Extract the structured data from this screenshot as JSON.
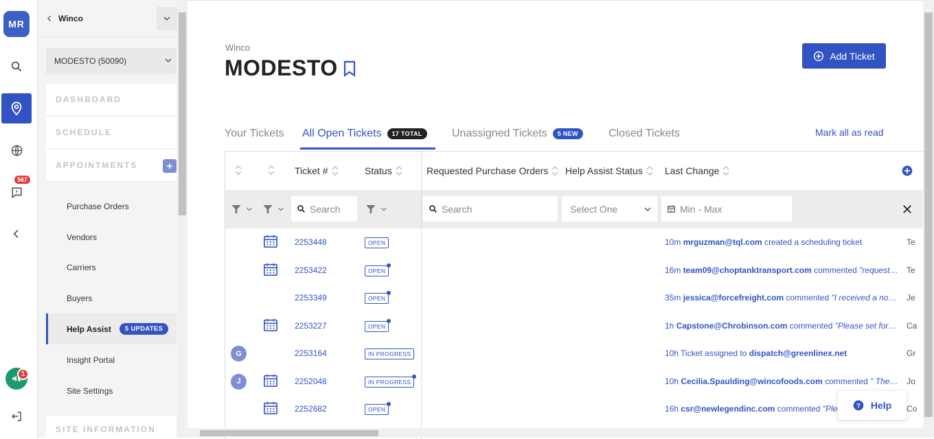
{
  "user": {
    "initials": "MR"
  },
  "rail": {
    "alert_count": "567",
    "announcement_count": "1"
  },
  "nav": {
    "org": "Winco",
    "site": "MODESTO (50090)",
    "sections": {
      "dashboard": "DASHBOARD",
      "schedule": "SCHEDULE",
      "appointments": "APPOINTMENTS",
      "site_information": "SITE INFORMATION"
    },
    "items": [
      {
        "label": "Purchase Orders"
      },
      {
        "label": "Vendors"
      },
      {
        "label": "Carriers"
      },
      {
        "label": "Buyers"
      },
      {
        "label": "Help Assist",
        "badge": "5 UPDATES"
      },
      {
        "label": "Insight Portal"
      },
      {
        "label": "Site Settings"
      }
    ]
  },
  "page": {
    "breadcrumb": "Winco",
    "title": "MODESTO",
    "add_ticket_label": "Add Ticket"
  },
  "tabs": [
    {
      "label": "Your Tickets"
    },
    {
      "label": "All Open Tickets",
      "badge": "17 TOTAL"
    },
    {
      "label": "Unassigned Tickets",
      "badge": "5 NEW"
    },
    {
      "label": "Closed Tickets"
    }
  ],
  "mark_all_read": "Mark all as read",
  "table": {
    "columns": {
      "ticket": "Ticket #",
      "status": "Status",
      "requested_po": "Requested Purchase Orders",
      "help_assist_status": "Help Assist Status",
      "last_change": "Last Change"
    },
    "filters": {
      "ticket_search": "Search",
      "po_search": "Search",
      "help_status": "Select One",
      "date_range": "Min - Max"
    },
    "rows": [
      {
        "ticket": "2253448",
        "status": "OPEN",
        "unread": false,
        "calendar": true,
        "avatar": "",
        "time": "10m",
        "actor": "mrguzman@tql.com",
        "action": " created a scheduling ticket",
        "comment": "",
        "target": "",
        "tail": "Te"
      },
      {
        "ticket": "2253422",
        "status": "OPEN",
        "unread": true,
        "calendar": true,
        "avatar": "",
        "time": "16m",
        "actor": "team09@choptanktransport.com",
        "action": " commented ",
        "comment": "\"requesting appointment\"",
        "target": "",
        "tail": "Te"
      },
      {
        "ticket": "2253349",
        "status": "OPEN",
        "unread": true,
        "calendar": false,
        "avatar": "",
        "time": "35m",
        "actor": "jessica@forcefreight.com",
        "action": " commented ",
        "comment": "\"I received a no call no show\"",
        "target": "",
        "tail": "Je"
      },
      {
        "ticket": "2253227",
        "status": "OPEN",
        "unread": true,
        "calendar": true,
        "avatar": "",
        "time": "1h",
        "actor": "Capstone@Chrobinson.com",
        "action": " commented ",
        "comment": "\"Please set for June\"",
        "target": "",
        "tail": "Ca"
      },
      {
        "ticket": "2253164",
        "status": "IN PROGRESS",
        "unread": false,
        "calendar": false,
        "avatar": "G",
        "time": "10h",
        "actor": "",
        "action": "Ticket assigned to ",
        "comment": "",
        "target": "dispatch@greenlinex.net",
        "tail": "Gr"
      },
      {
        "ticket": "2252048",
        "status": "IN PROGRESS",
        "unread": true,
        "calendar": true,
        "avatar": "J",
        "time": "10h",
        "actor": "Cecilia.Spaulding@wincofoods.com",
        "action": " commented ",
        "comment": "\" The due date\"",
        "target": "",
        "tail": "Jo"
      },
      {
        "ticket": "2252682",
        "status": "OPEN",
        "unread": true,
        "calendar": true,
        "avatar": "",
        "time": "16h",
        "actor": "csr@newlegendinc.com",
        "action": " commented ",
        "comment": "\"Please",
        "target": "",
        "tail": "Co"
      }
    ]
  },
  "help": {
    "label": "Help"
  },
  "colors": {
    "primary": "#3253c4",
    "badge_red": "#e53935",
    "megaphone": "#1b9a6b"
  }
}
